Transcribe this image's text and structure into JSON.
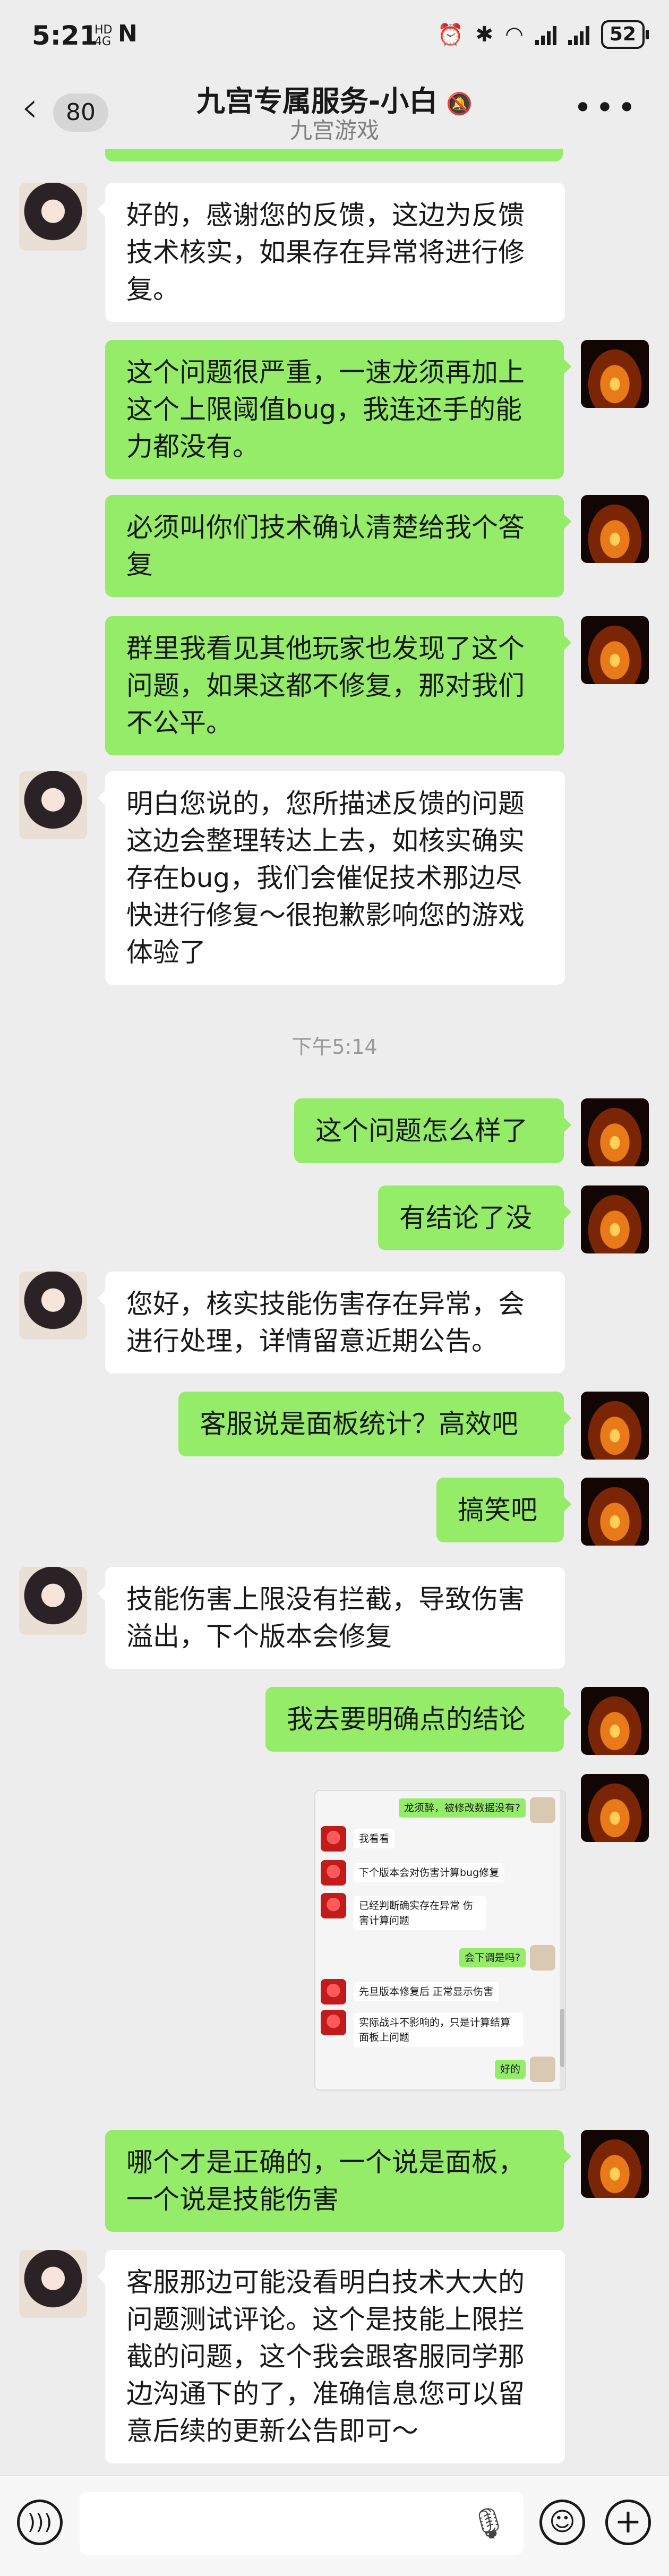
{
  "status_bar": {
    "time": "5:21",
    "mini_top": "HD",
    "mini_bottom": "4G",
    "n_icon": "N",
    "battery": "52"
  },
  "header": {
    "back_count": "80",
    "title": "九宫专属服务-小白",
    "mute_icon": "mute-icon",
    "subtitle": "九宫游戏"
  },
  "messages": [
    {
      "side": "in",
      "text": "好的，感谢您的反馈，这边为反馈技术核实，如果存在异常将进行修复。"
    },
    {
      "side": "out",
      "text": "这个问题很严重，一速龙须再加上这个上限阈值bug，我连还手的能力都没有。"
    },
    {
      "side": "out",
      "text": "必须叫你们技术确认清楚给我个答复"
    },
    {
      "side": "out",
      "text": "群里我看见其他玩家也发现了这个问题，如果这都不修复，那对我们不公平。"
    },
    {
      "side": "in",
      "text": "明白您说的，您所描述反馈的问题这边会整理转达上去，如核实确实存在bug，我们会催促技术那边尽快进行修复～很抱歉影响您的游戏体验了"
    },
    {
      "side": "time",
      "text": "下午5:14"
    },
    {
      "side": "out",
      "text": "这个问题怎么样了"
    },
    {
      "side": "out",
      "text": "有结论了没"
    },
    {
      "side": "in",
      "text": "您好，核实技能伤害存在异常，会进行处理，详情留意近期公告。"
    },
    {
      "side": "out",
      "text": "客服说是面板统计？高效吧"
    },
    {
      "side": "out",
      "text": "搞笑吧"
    },
    {
      "side": "in",
      "text": "技能伤害上限没有拦截，导致伤害溢出，下个版本会修复"
    },
    {
      "side": "out",
      "text": "我去要明确点的结论"
    },
    {
      "side": "out",
      "text": "哪个才是正确的，一个说是面板，一个说是技能伤害"
    },
    {
      "side": "in",
      "text": "客服那边可能没看明白技术大大的问题测试评论。这个是技能上限拦截的问题，这个我会跟客服同学那边沟通下的了，准确信息您可以留意后续的更新公告即可～"
    }
  ],
  "screenshot": {
    "lines": [
      "龙须醉，被修改数据没有?",
      "我看看",
      "下个版本会对伤害计算bug修复",
      "已经判断确实存在异常 伤害计算问题",
      "会下调是吗?",
      "先旦版本修复后 正常显示伤害",
      "实际战斗不影响的，只是计算结算面板上问题",
      "好的"
    ]
  },
  "input_bar": {
    "voice_icon": "voice-icon",
    "mic_icon": "mic-icon",
    "emoji_icon": "emoji-icon",
    "plus_icon": "plus-icon"
  }
}
